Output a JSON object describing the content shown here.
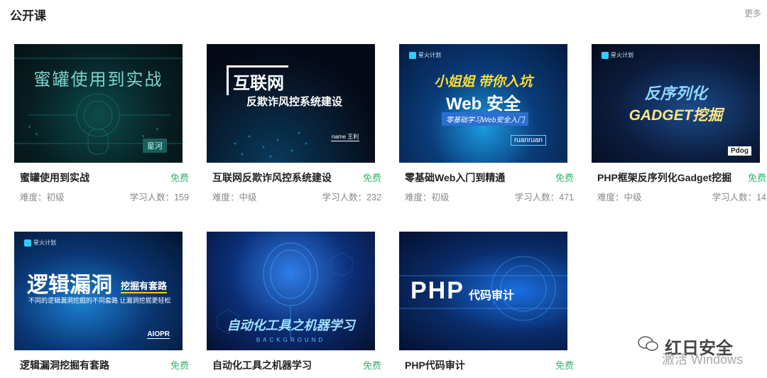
{
  "header": {
    "title": "公开课",
    "more": "更多"
  },
  "labels": {
    "level_prefix": "难度：",
    "count_prefix": "学习人数："
  },
  "courses": [
    {
      "thumb_text": "蜜罐使用到实战",
      "thumb_sub": "星河",
      "title": "蜜罐使用到实战",
      "price": "免费",
      "level": "初级",
      "count": "159"
    },
    {
      "thumb_text": "互联网",
      "thumb_sub": "反欺诈风控系统建设",
      "thumb_tag": "name 王利",
      "title": "互联网反欺诈风控系统建设",
      "price": "免费",
      "level": "中级",
      "count": "232"
    },
    {
      "thumb_text": "小姐姐 带你入坑",
      "thumb_sub": "Web 安全",
      "thumb_tag": "零基础学习Web安全入门",
      "thumb_author": "ruanruan",
      "logo": "星火计划",
      "title": "零基础Web入门到精通",
      "price": "免费",
      "level": "初级",
      "count": "471"
    },
    {
      "thumb_text": "反序列化",
      "thumb_sub": "GADGET挖掘",
      "thumb_author": "Pdog",
      "logo": "星火计划",
      "title": "PHP框架反序列化Gadget挖掘",
      "price": "免费",
      "level": "中级",
      "count": "14"
    },
    {
      "thumb_text": "逻辑漏洞",
      "thumb_sub": "挖掘有套路",
      "thumb_tag": "不同的逻辑漏洞挖掘的不同套路 让漏洞挖掘更轻松",
      "thumb_author": "AIOPR",
      "logo": "星火计划",
      "title": "逻辑漏洞挖掘有套路",
      "price": "免费"
    },
    {
      "thumb_text": "自动化工具之机器学习",
      "thumb_sub": "BACKGROUND",
      "title": "自动化工具之机器学习",
      "price": "免费"
    },
    {
      "thumb_text": "PHP",
      "thumb_sub": "代码审计",
      "title": "PHP代码审计",
      "price": "免费"
    }
  ],
  "watermark": {
    "brand": "红日安全",
    "activate": "激活 Windows"
  }
}
